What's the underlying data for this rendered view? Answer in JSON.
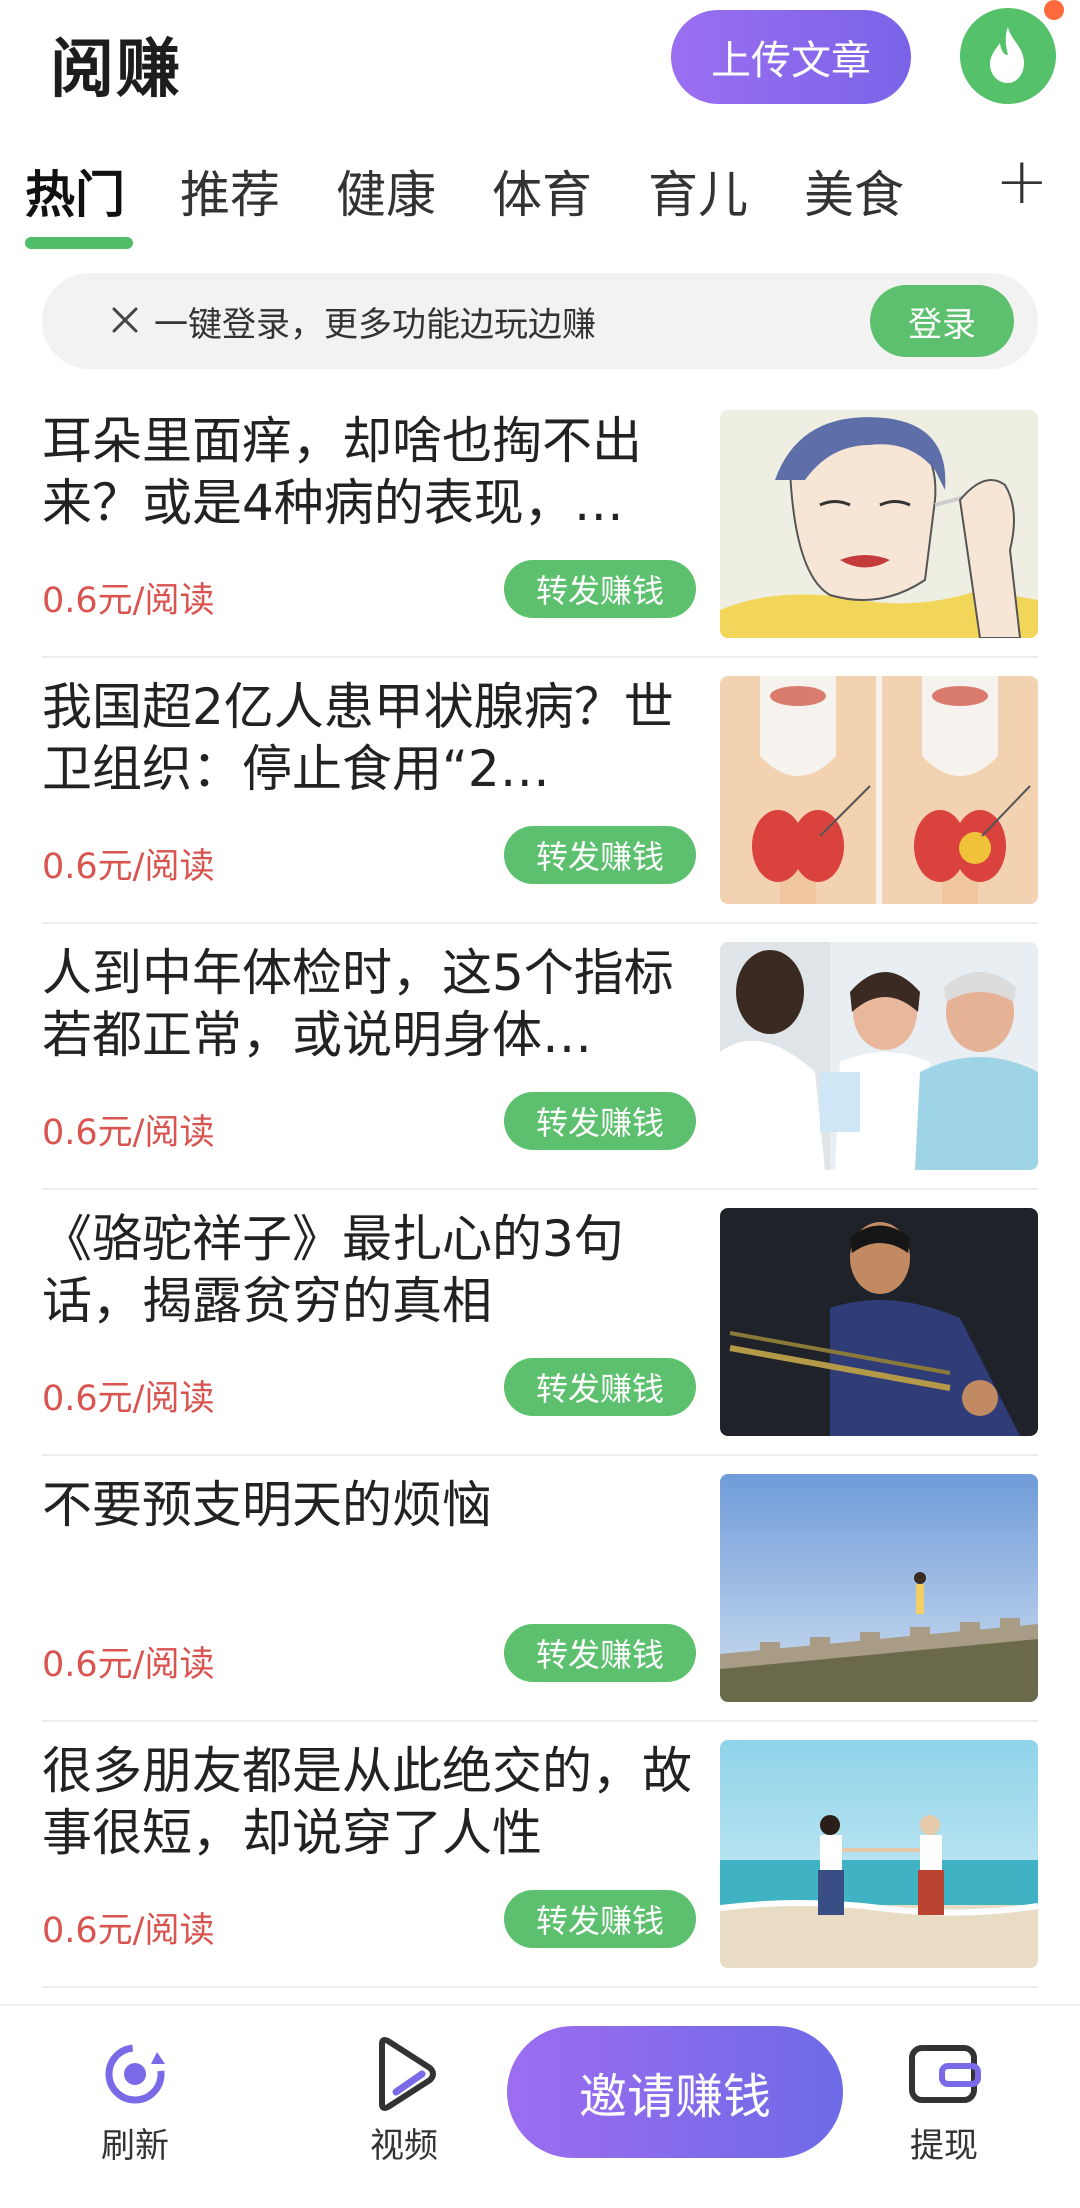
{
  "header": {
    "app_title": "阅赚",
    "upload_label": "上传文章",
    "avatar_icon": "flame-icon",
    "accent_color": "#8a68ee"
  },
  "tabs": [
    {
      "label": "热门",
      "active": true
    },
    {
      "label": "推荐",
      "active": false
    },
    {
      "label": "健康",
      "active": false
    },
    {
      "label": "体育",
      "active": false
    },
    {
      "label": "育儿",
      "active": false
    },
    {
      "label": "美食",
      "active": false
    }
  ],
  "tab_more_icon": "plus-icon",
  "login_banner": {
    "text": "一键登录，更多功能边玩边赚",
    "button_label": "登录"
  },
  "articles": [
    {
      "title": "耳朵里面痒，却啥也掏不出来？或是4种病的表现，…",
      "price": "0.6元/阅读",
      "share_label": "转发赚钱",
      "image": "woman-cleaning-ear-illustration"
    },
    {
      "title": "我国超2亿人患甲状腺病？世卫组织：停止食用“2…",
      "price": "0.6元/阅读",
      "share_label": "转发赚钱",
      "image": "thyroid-illustration"
    },
    {
      "title": "人到中年体检时，这5个指标若都正常，或说明身体…",
      "price": "0.6元/阅读",
      "share_label": "转发赚钱",
      "image": "doctor-with-elderly-couple"
    },
    {
      "title": "《骆驼祥子》最扎心的3句话，揭露贫穷的真相",
      "price": "0.6元/阅读",
      "share_label": "转发赚钱",
      "image": "man-pulling-rickshaw"
    },
    {
      "title": "不要预支明天的烦恼",
      "price": "0.6元/阅读",
      "share_label": "转发赚钱",
      "image": "person-on-great-wall"
    },
    {
      "title": "很多朋友都是从此绝交的，故事很短，却说穿了人性",
      "price": "0.6元/阅读",
      "share_label": "转发赚钱",
      "image": "two-women-on-beach"
    }
  ],
  "bottom_nav": {
    "refresh_label": "刷新",
    "video_label": "视频",
    "invite_label": "邀请赚钱",
    "withdraw_label": "提现"
  },
  "colors": {
    "green": "#5cc06e",
    "price_red": "#d9534f",
    "purple": "#8a68ee"
  }
}
